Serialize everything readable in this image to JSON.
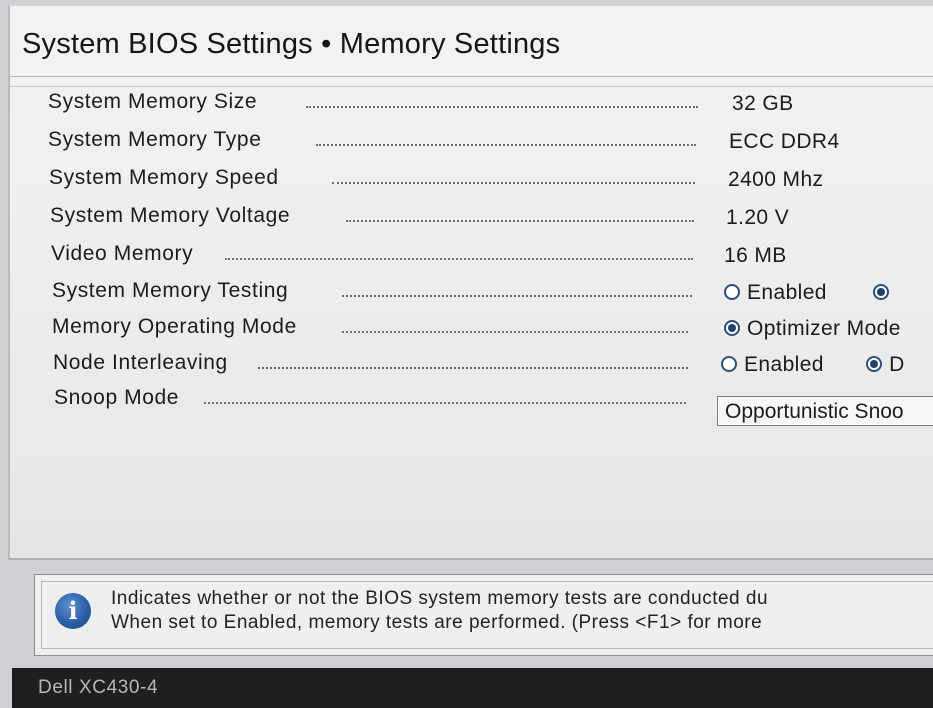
{
  "header": {
    "title": "System BIOS Settings • Memory Settings"
  },
  "settings": [
    {
      "label": "System Memory Size",
      "value": "32 GB"
    },
    {
      "label": "System Memory Type",
      "value": "ECC DDR4"
    },
    {
      "label": "System Memory Speed",
      "value": "2400 Mhz"
    },
    {
      "label": "System Memory Voltage",
      "value": "1.20 V"
    },
    {
      "label": "Video Memory",
      "value": "16 MB"
    },
    {
      "label": "System Memory Testing",
      "options": [
        "Enabled",
        ""
      ],
      "selected": 1
    },
    {
      "label": "Memory Operating Mode",
      "options": [
        "Optimizer Mode"
      ],
      "selected": 0
    },
    {
      "label": "Node Interleaving",
      "options": [
        "Enabled",
        "D"
      ],
      "selected": 1
    },
    {
      "label": "Snoop Mode",
      "select_value": "Opportunistic Snoo"
    }
  ],
  "help": {
    "line1": "Indicates whether or not the BIOS system memory tests are conducted du",
    "line2": "When set to Enabled, memory tests are performed. (Press <F1> for more"
  },
  "footer": {
    "model": "Dell XC430-4"
  },
  "colors": {
    "radio_selected": "#1d3f6b",
    "info_icon": "#2a5fa7",
    "footer_bg": "#1e1f21"
  }
}
